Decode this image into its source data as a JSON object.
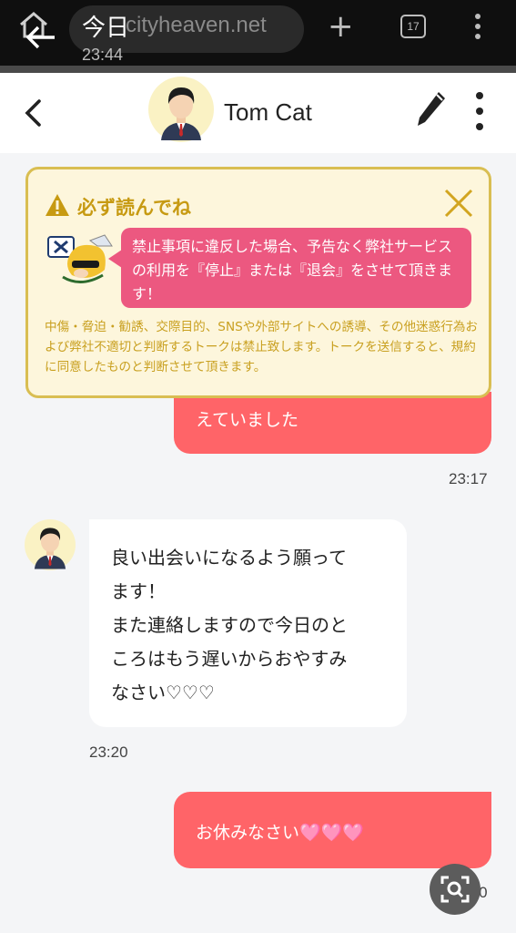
{
  "browser": {
    "title": "今日",
    "url": "cityheaven.net",
    "time": "23:44",
    "tab_count": "17"
  },
  "header": {
    "contact_name": "Tom Cat"
  },
  "notice": {
    "title": "必ず読んでね",
    "warning": "禁止事項に違反した場合、予告なく弊社サービスの利用を『停止』または『退会』をさせて頂きます！",
    "rules": "中傷・脅迫・勧誘、交際目的、SNSや外部サイトへの誘導、その他迷惑行為および弊社不適切と判断するトークは禁止致します。トークを送信すると、規約に同意したものと判断させて頂きます。"
  },
  "messages": [
    {
      "side": "out",
      "text": "えていました",
      "time": "23:17"
    },
    {
      "side": "in",
      "lines": [
        "良い出会いになるよう願って",
        "ます！",
        "また連絡しますので今日のと",
        "ころはもう遅いからおやすみ",
        "なさい♡♡♡"
      ],
      "time": "23:20"
    },
    {
      "side": "out",
      "text": "お休みなさい🩷🩷🩷",
      "time": "23:20"
    }
  ],
  "colors": {
    "outgoing_bubble": "#ff6468",
    "notice_border": "#d9be52",
    "notice_pink": "#ec5880"
  }
}
